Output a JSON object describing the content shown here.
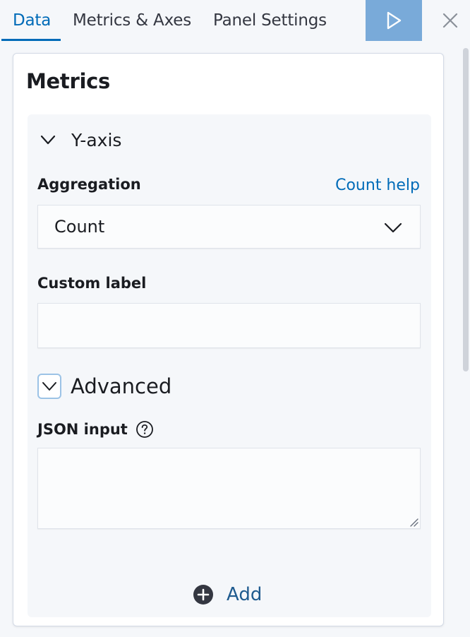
{
  "tabs": [
    {
      "label": "Data",
      "active": true
    },
    {
      "label": "Metrics & Axes",
      "active": false
    },
    {
      "label": "Panel Settings",
      "active": false
    }
  ],
  "toolbar": {
    "run_icon": "play-icon",
    "close_icon": "close-icon"
  },
  "panel": {
    "title": "Metrics",
    "aggregation_item": {
      "title": "Y-axis",
      "expanded": true,
      "aggregation_label": "Aggregation",
      "help_link": "Count help",
      "aggregation_value": "Count",
      "custom_label_label": "Custom label",
      "custom_label_value": "",
      "advanced_label": "Advanced",
      "advanced_expanded": true,
      "json_input_label": "JSON input",
      "json_input_value": ""
    },
    "add_label": "Add"
  },
  "colors": {
    "accent": "#006bb8",
    "run_button": "#79aad9",
    "add_icon": "#343741",
    "panel_bg": "#ffffff",
    "page_bg": "#f5f7fa"
  }
}
